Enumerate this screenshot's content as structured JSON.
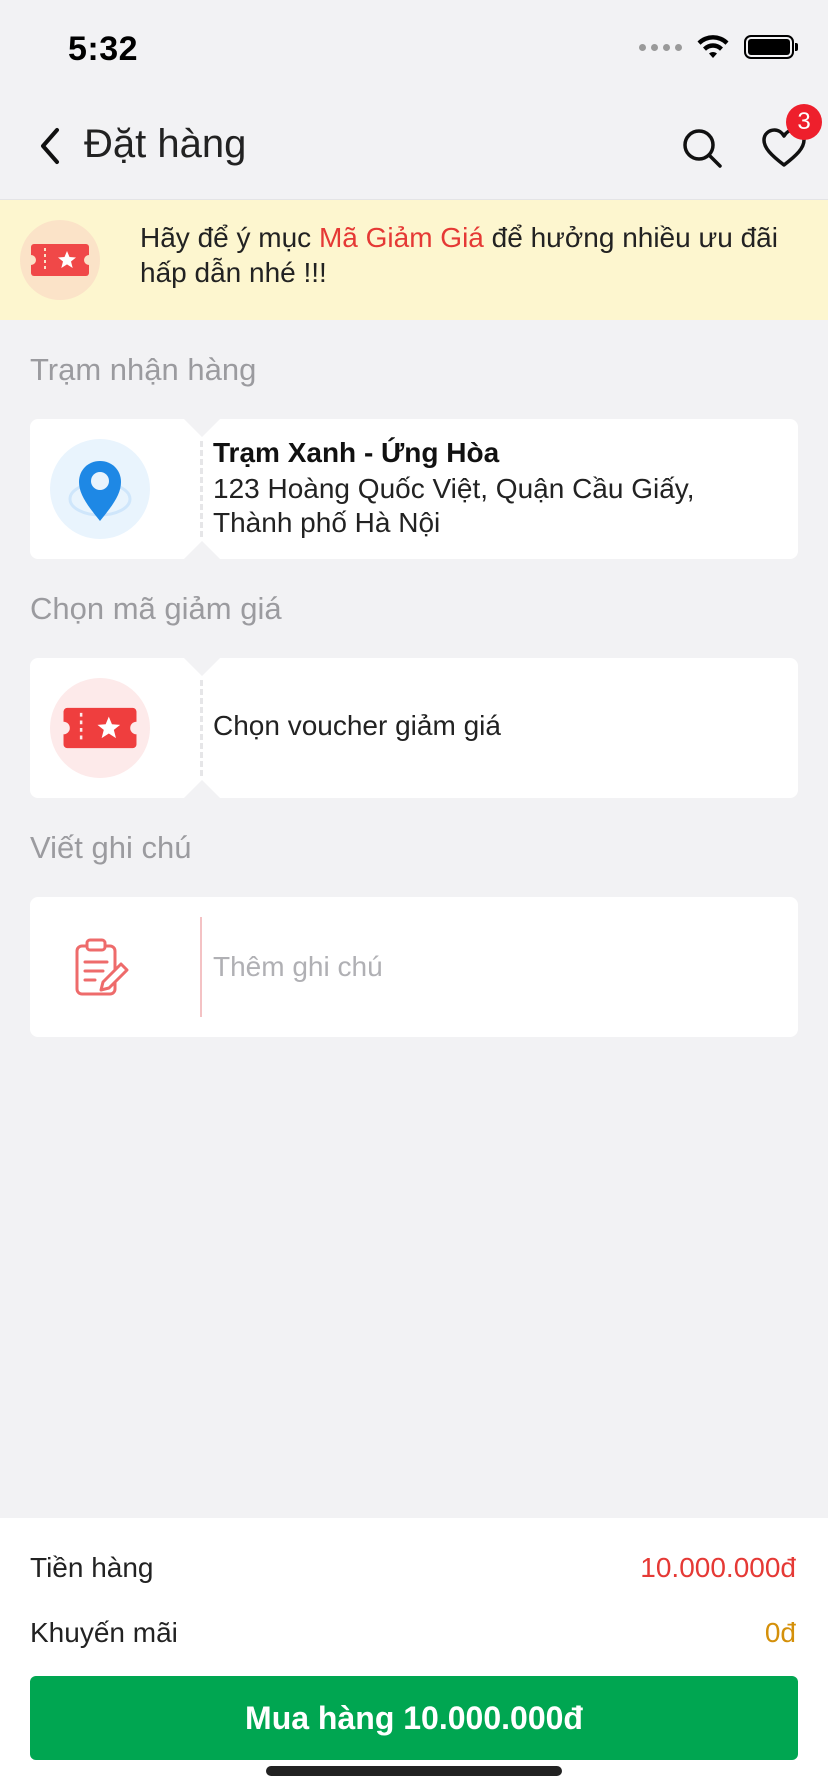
{
  "status_bar": {
    "time": "5:32"
  },
  "nav": {
    "title": "Đặt hàng",
    "badge_count": "3",
    "icons": [
      "chevron-left-icon",
      "search-icon",
      "heart-icon"
    ]
  },
  "promo": {
    "text_before": "Hãy để ý mục ",
    "highlight": "Mã Giảm Giá",
    "text_after": " để hưởng nhiều ưu đãi hấp dẫn nhé !!!",
    "highlight_color": "#e53935",
    "icon": "ticket-icon"
  },
  "pickup": {
    "section_label": "Trạm nhận hàng",
    "station_name": "Trạm Xanh - Ứng Hòa",
    "address_line1": "123 Hoàng Quốc Việt, Quận Cầu Giấy,",
    "address_line2": "Thành phố Hà Nội",
    "icon": "location-pin-icon"
  },
  "voucher": {
    "section_label": "Chọn mã giảm giá",
    "placeholder": "Chọn voucher giảm giá",
    "icon": "ticket-icon"
  },
  "note": {
    "section_label": "Viết ghi chú",
    "placeholder": "Thêm ghi chú",
    "value": "",
    "icon": "clipboard-edit-icon"
  },
  "summary": {
    "subtotal_label": "Tiền hàng",
    "subtotal_value": "10.000.000đ",
    "discount_label": "Khuyến mãi",
    "discount_value": "0đ",
    "buy_button_label": "Mua hàng 10.000.000đ"
  },
  "colors": {
    "accent_green": "#00a651",
    "price_red": "#e53935",
    "discount_orange": "#d4900a",
    "badge_red": "#ee1f2c",
    "banner_bg": "#fdf6cf"
  }
}
